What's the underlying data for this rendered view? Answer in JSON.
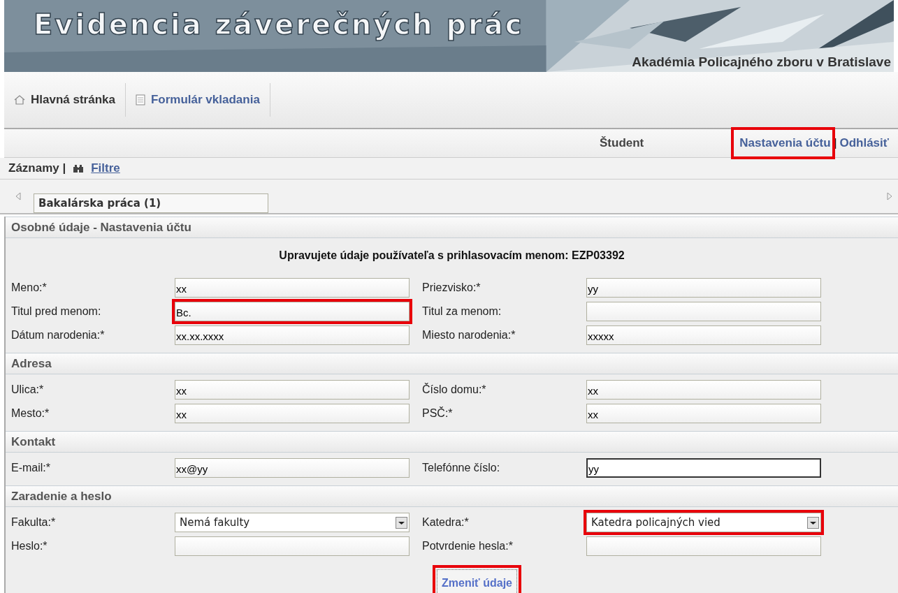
{
  "header": {
    "title": "Evidencia záverečných prác",
    "subtitle": "Akadémia Policajného zboru v Bratislave"
  },
  "nav": [
    {
      "label": "Hlavná stránka",
      "kind": "home"
    },
    {
      "label": "Formulár vkladania",
      "kind": "form"
    }
  ],
  "user_bar": {
    "role": "Študent",
    "links": [
      {
        "label": "Nastavenia účtu",
        "highlighted": true
      },
      {
        "label": "Odhlásiť",
        "highlighted": false
      }
    ],
    "separator": "|"
  },
  "records_bar": {
    "label": "Záznamy |",
    "filter_link": "Filtre"
  },
  "tabs": [
    {
      "label": "Bakalárska práca (1)",
      "selected": true
    }
  ],
  "panel_title": "Osobné údaje - Nastavenia účtu",
  "intro": "Upravujete údaje používateľa s prihlasovacím menom: EZP03392",
  "sections": [
    {
      "rows": [
        [
          {
            "label": "Meno:*",
            "value": "xx",
            "kind": "text",
            "highlighted": false,
            "focused": false
          },
          {
            "label": "Priezvisko:*",
            "value": "yy",
            "kind": "text",
            "highlighted": false,
            "focused": false
          }
        ],
        [
          {
            "label": "Titul pred menom:",
            "value": "Bc.",
            "kind": "text",
            "highlighted": true,
            "focused": false
          },
          {
            "label": "Titul za menom:",
            "kind": "text",
            "highlighted": false,
            "focused": false
          }
        ],
        [
          {
            "label": "Dátum narodenia:*",
            "value": "xx.xx.xxxx",
            "kind": "text",
            "highlighted": false,
            "focused": false
          },
          {
            "label": "Miesto narodenia:*",
            "value": "xxxxx",
            "kind": "text",
            "highlighted": false,
            "focused": false
          }
        ]
      ]
    },
    {
      "title": "Adresa",
      "rows": [
        [
          {
            "label": "Ulica:*",
            "value": "xx",
            "kind": "text",
            "highlighted": false,
            "focused": false
          },
          {
            "label": "Číslo domu:*",
            "value": "xx",
            "kind": "text",
            "highlighted": false,
            "focused": false
          }
        ],
        [
          {
            "label": "Mesto:*",
            "value": "xx",
            "kind": "text",
            "highlighted": false,
            "focused": false
          },
          {
            "label": "PSČ:*",
            "value": "xx",
            "kind": "text",
            "highlighted": false,
            "focused": false
          }
        ]
      ]
    },
    {
      "title": "Kontakt",
      "rows": [
        [
          {
            "label": "E-mail:*",
            "value": "xx@yy",
            "kind": "text",
            "highlighted": false,
            "focused": false
          },
          {
            "label": "Telefónne číslo:",
            "value": "yy",
            "kind": "text",
            "highlighted": false,
            "focused": true
          }
        ]
      ]
    },
    {
      "title": "Zaradenie a heslo",
      "rows": [
        [
          {
            "label": "Fakulta:*",
            "value": "Nemá fakulty",
            "kind": "select",
            "highlighted": false,
            "focused": false
          },
          {
            "label": "Katedra:*",
            "value": "Katedra policajných vied",
            "kind": "select",
            "highlighted": true,
            "focused": false
          }
        ],
        [
          {
            "label": "Heslo:*",
            "kind": "password",
            "highlighted": false,
            "focused": false
          },
          {
            "label": "Potvrdenie hesla:*",
            "kind": "password",
            "highlighted": false,
            "focused": false
          }
        ]
      ]
    }
  ],
  "submit": {
    "label": "Zmeniť údaje",
    "highlighted": true
  }
}
